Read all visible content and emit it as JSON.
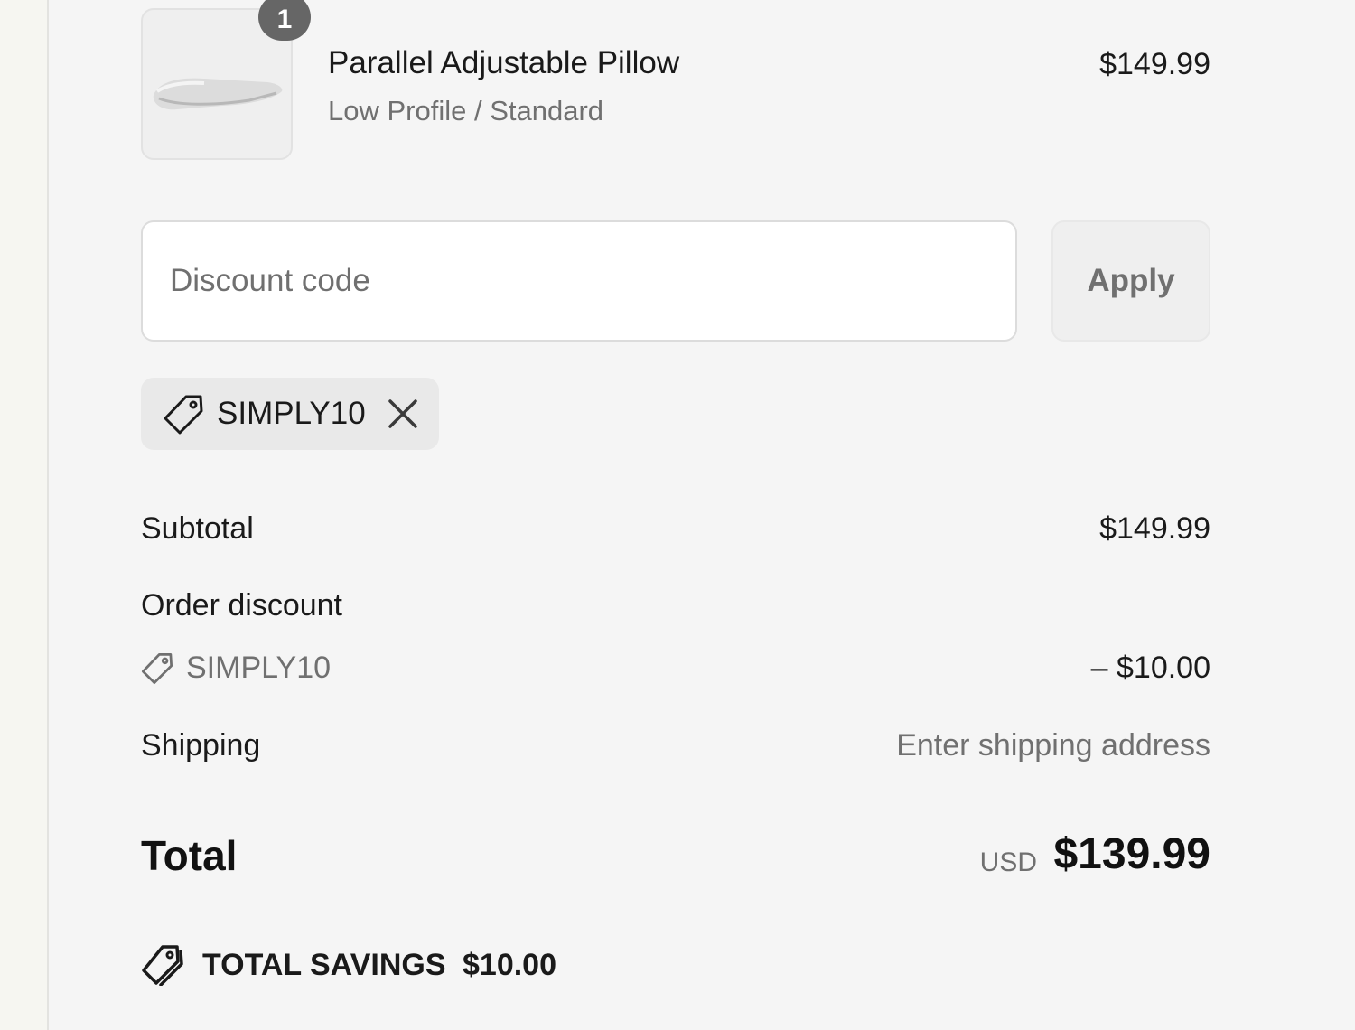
{
  "product": {
    "quantity": "1",
    "name": "Parallel Adjustable Pillow",
    "variant": "Low Profile / Standard",
    "price": "$149.99",
    "image_icon": "pillow-image"
  },
  "discount": {
    "placeholder": "Discount code",
    "apply_label": "Apply",
    "applied_code": "SIMPLY10",
    "tag_icon": "tag-icon",
    "remove_icon": "close-icon"
  },
  "summary": {
    "subtotal_label": "Subtotal",
    "subtotal_value": "$149.99",
    "order_discount_label": "Order discount",
    "order_discount_code": "SIMPLY10",
    "order_discount_value": "– $10.00",
    "shipping_label": "Shipping",
    "shipping_value": "Enter shipping address",
    "total_label": "Total",
    "total_currency": "USD",
    "total_value": "$139.99",
    "savings_label": "TOTAL SAVINGS",
    "savings_value": "$10.00"
  },
  "colors": {
    "background": "#f5f5f5",
    "text": "#1a1a1a",
    "muted_text": "#707070",
    "badge": "#666666"
  }
}
